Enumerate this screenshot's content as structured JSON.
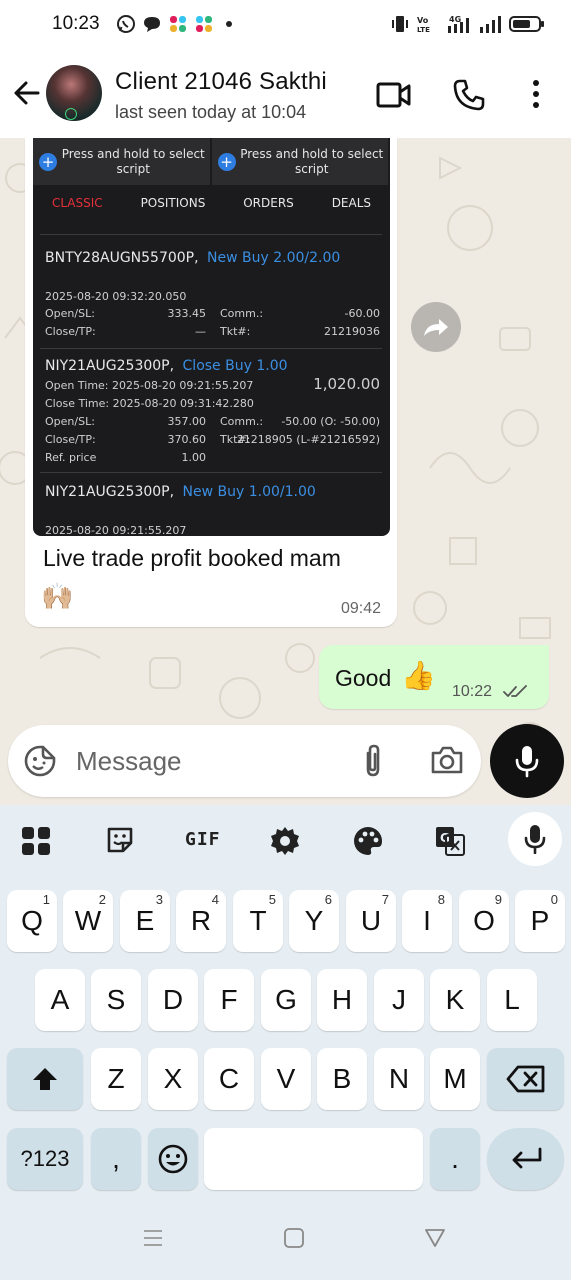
{
  "status_bar": {
    "time": "10:23",
    "network_label": "4G",
    "volte_label": "VoLTE"
  },
  "header": {
    "contact_name": "Client 21046 Sakthi",
    "last_seen": "last seen today at 10:04"
  },
  "screenshot": {
    "search_left": "Press and hold to select script",
    "search_right": "Press and hold to select script",
    "tabs": [
      "CLASSIC",
      "POSITIONS",
      "ORDERS",
      "DEALS"
    ],
    "active_tab": "CLASSIC",
    "trade1": {
      "symbol": "BNTY28AUGN55700P,",
      "action": "New Buy 2.00/2.00",
      "time": "2025-08-20 09:32:20.050",
      "open_label": "Open/SL:",
      "open_value": "333.45",
      "comm_label": "Comm.:",
      "comm_value": "-60.00",
      "close_label": "Close/TP:",
      "close_value": "—",
      "tkt_label": "Tkt#:",
      "tkt_value": "21219036"
    },
    "trade2": {
      "symbol": "NIY21AUG25300P,",
      "action": "Close Buy 1.00",
      "profit": "1,020.00",
      "open_time": "Open Time: 2025-08-20 09:21:55.207",
      "close_time": "Close Time: 2025-08-20 09:31:42.280",
      "open_label": "Open/SL:",
      "open_value": "357.00",
      "comm_label": "Comm.:",
      "comm_value": "-50.00 (O: -50.00)",
      "close_label": "Close/TP:",
      "close_value": "370.60",
      "tkt_label": "Tkt#:",
      "tkt_value": "21218905 (L-#21216592)",
      "ref_label": "Ref. price",
      "ref_value": "1.00"
    },
    "trade3": {
      "symbol": "NIY21AUG25300P,",
      "action": "New Buy 1.00/1.00",
      "time": "2025-08-20 09:21:55.207"
    }
  },
  "messages": {
    "incoming_caption": "Live trade profit booked mam",
    "incoming_emoji": "🙌🏼",
    "incoming_time": "09:42",
    "outgoing_text": "Good",
    "outgoing_emoji": "👍",
    "outgoing_time": "10:22"
  },
  "composer": {
    "placeholder": "Message"
  },
  "keyboard": {
    "toolbar_gif": "GIF",
    "row1": [
      {
        "k": "Q",
        "h": "1"
      },
      {
        "k": "W",
        "h": "2"
      },
      {
        "k": "E",
        "h": "3"
      },
      {
        "k": "R",
        "h": "4"
      },
      {
        "k": "T",
        "h": "5"
      },
      {
        "k": "Y",
        "h": "6"
      },
      {
        "k": "U",
        "h": "7"
      },
      {
        "k": "I",
        "h": "8"
      },
      {
        "k": "O",
        "h": "9"
      },
      {
        "k": "P",
        "h": "0"
      }
    ],
    "row2": [
      "A",
      "S",
      "D",
      "F",
      "G",
      "H",
      "J",
      "K",
      "L"
    ],
    "row3": [
      "Z",
      "X",
      "C",
      "V",
      "B",
      "N",
      "M"
    ],
    "symbols_key": "?123",
    "comma_key": ",",
    "period_key": "."
  },
  "colors": {
    "chat_bg": "#efeae2",
    "outgoing_bubble": "#d9fdd3",
    "accent_blue": "#3b8fe3",
    "active_tab_red": "#e5303a",
    "keyboard_bg": "#e6eef3"
  }
}
